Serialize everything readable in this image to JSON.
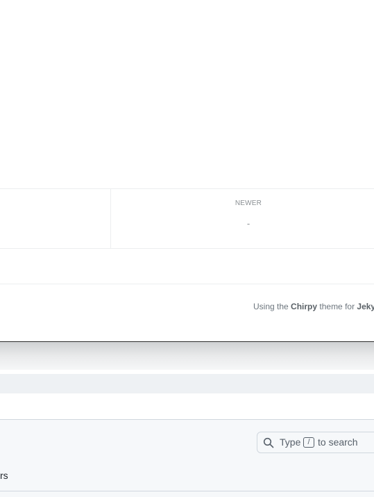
{
  "post_nav": {
    "older": {
      "label": "",
      "title": ""
    },
    "newer": {
      "label": "NEWER",
      "title": "-"
    }
  },
  "footer": {
    "prefix": "Using the ",
    "theme_name": "Chirpy",
    "middle": " theme for ",
    "engine_name": "Jekyll"
  },
  "lower_window": {
    "search": {
      "pre_text": "Type",
      "key": "/",
      "post_text": "to search"
    },
    "nav_tab_fragment": "rs"
  }
}
